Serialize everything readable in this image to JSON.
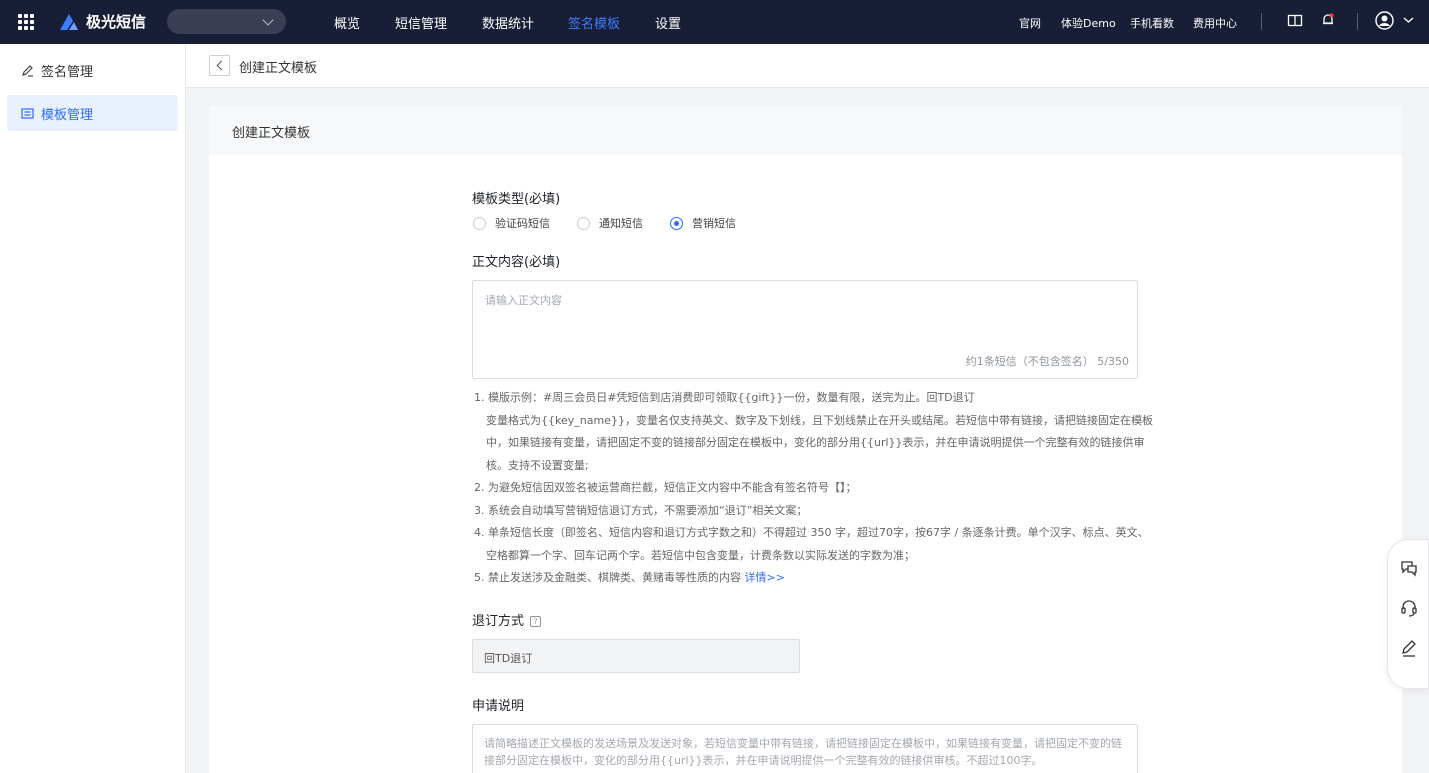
{
  "topbar": {
    "brand": "极光短信",
    "nav": [
      "概览",
      "短信管理",
      "数据统计",
      "签名模板",
      "设置"
    ],
    "active_nav": "签名模板",
    "links": [
      "官网",
      "体验Demo",
      "手机看数",
      "费用中心"
    ]
  },
  "sidebar": {
    "items": [
      {
        "label": "签名管理",
        "active": false
      },
      {
        "label": "模板管理",
        "active": true
      }
    ]
  },
  "page_header": {
    "title": "创建正文模板"
  },
  "card": {
    "title": "创建正文模板",
    "template_type": {
      "label": "模板类型(必填)",
      "options": [
        "验证码短信",
        "通知短信",
        "营销短信"
      ],
      "selected": "营销短信"
    },
    "content": {
      "label": "正文内容(必填)",
      "placeholder": "请输入正文内容",
      "counter": "约1条短信（不包含签名） 5/350"
    },
    "notes": {
      "line1": "1. 模版示例：#周三会员日#凭短信到店消费即可领取{{gift}}一份，数量有限，送完为止。回TD退订",
      "line1b": "变量格式为{{key_name}}，变量名仅支持英文、数字及下划线，且下划线禁止在开头或结尾。若短信中带有链接，请把链接固定在模板",
      "line1c": "中，如果链接有变量，请把固定不变的链接部分固定在模板中，变化的部分用{{url}}表示，并在申请说明提供一个完整有效的链接供审",
      "line1d": "核。支持不设置变量;",
      "line2": "2. 为避免短信因双签名被运营商拦截，短信正文内容中不能含有签名符号【】；",
      "line3": "3. 系统会自动填写营销短信退订方式，不需要添加“退订”相关文案；",
      "line4": "4. 单条短信长度（即签名、短信内容和退订方式字数之和）不得超过 350 字，超过70字，按67字 / 条逐条计费。单个汉字、标点、英文、",
      "line4b": "空格都算一个字、回车记两个字。若短信中包含变量，计费条数以实际发送的字数为准；",
      "line5": "5. 禁止发送涉及金融类、棋牌类、黄赌毒等性质的内容 ",
      "details_link": "详情>>"
    },
    "unsubscribe": {
      "label": "退订方式",
      "value": "回TD退订"
    },
    "application": {
      "label": "申请说明",
      "placeholder": "请简略描述正文模板的发送场景及发送对象，若短信变量中带有链接，请把链接固定在模板中，如果链接有变量，请把固定不变的链接部分固定在模板中，变化的部分用{{url}}表示，并在申请说明提供一个完整有效的链接供审核。不超过100字。"
    }
  },
  "colors": {
    "accent": "#2f6cf6",
    "topbar": "#181e35"
  }
}
